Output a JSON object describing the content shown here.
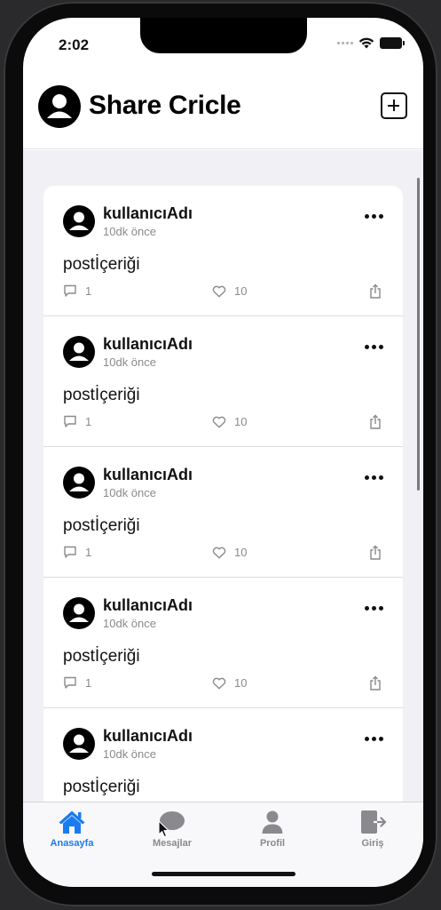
{
  "status_bar": {
    "time": "2:02"
  },
  "header": {
    "title": "Share Cricle"
  },
  "posts": [
    {
      "username": "kullanıcıAdı",
      "time_ago": "10dk önce",
      "content": "postİçeriği",
      "comments": "1",
      "likes": "10"
    },
    {
      "username": "kullanıcıAdı",
      "time_ago": "10dk önce",
      "content": "postİçeriği",
      "comments": "1",
      "likes": "10"
    },
    {
      "username": "kullanıcıAdı",
      "time_ago": "10dk önce",
      "content": "postİçeriği",
      "comments": "1",
      "likes": "10"
    },
    {
      "username": "kullanıcıAdı",
      "time_ago": "10dk önce",
      "content": "postİçeriği",
      "comments": "1",
      "likes": "10"
    },
    {
      "username": "kullanıcıAdı",
      "time_ago": "10dk önce",
      "content": "postİçeriği"
    }
  ],
  "tabbar": {
    "home": "Anasayfa",
    "messages": "Mesajlar",
    "profile": "Profil",
    "login": "Giriş"
  },
  "colors": {
    "accent": "#1a7cf0",
    "background": "#f0f0f5"
  }
}
